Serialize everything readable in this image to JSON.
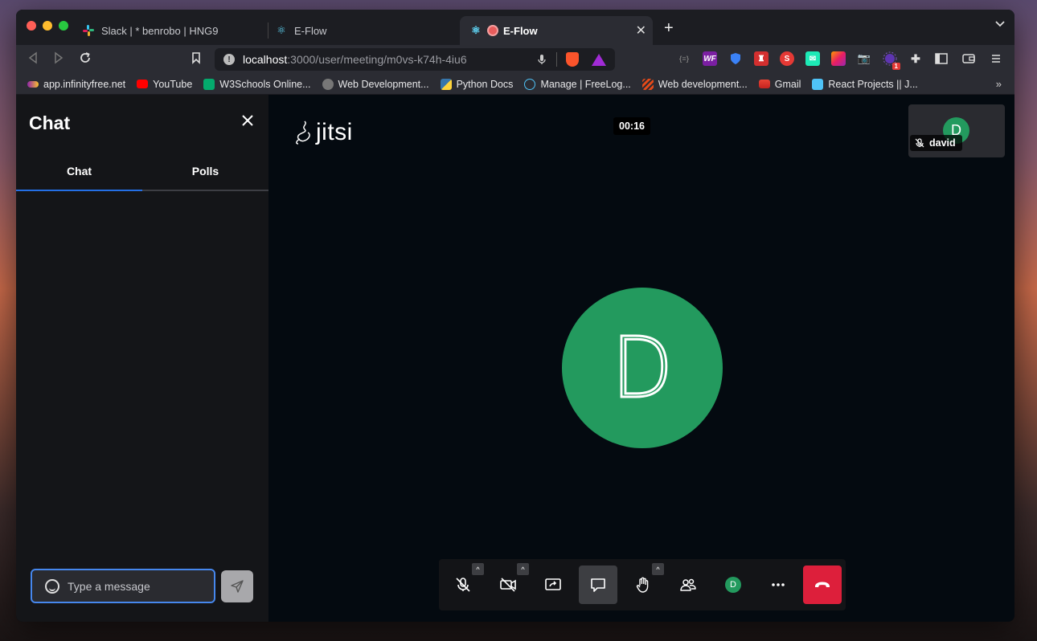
{
  "browser": {
    "tabs": [
      {
        "title": "Slack | * benrobo | HNG9"
      },
      {
        "title": "E-Flow"
      },
      {
        "title": "E-Flow",
        "active": true
      }
    ],
    "url_host": "localhost",
    "url_path": ":3000/user/meeting/m0vs-k74h-4iu6",
    "bookmarks": [
      "app.infinityfree.net",
      "YouTube",
      "W3Schools Online...",
      "Web Development...",
      "Python Docs",
      "Manage | FreeLog...",
      "Web development...",
      "Gmail",
      "React Projects || J..."
    ],
    "extension_badge": "1"
  },
  "chat": {
    "title": "Chat",
    "tabs": [
      "Chat",
      "Polls"
    ],
    "input_placeholder": "Type a message"
  },
  "meeting": {
    "logo_text": "jitsi",
    "timer": "00:16",
    "participant_name": "david",
    "participant_initial": "D"
  },
  "colors": {
    "avatar": "#239a5e",
    "accent": "#246fe5",
    "hangup": "#dd1f3b"
  }
}
